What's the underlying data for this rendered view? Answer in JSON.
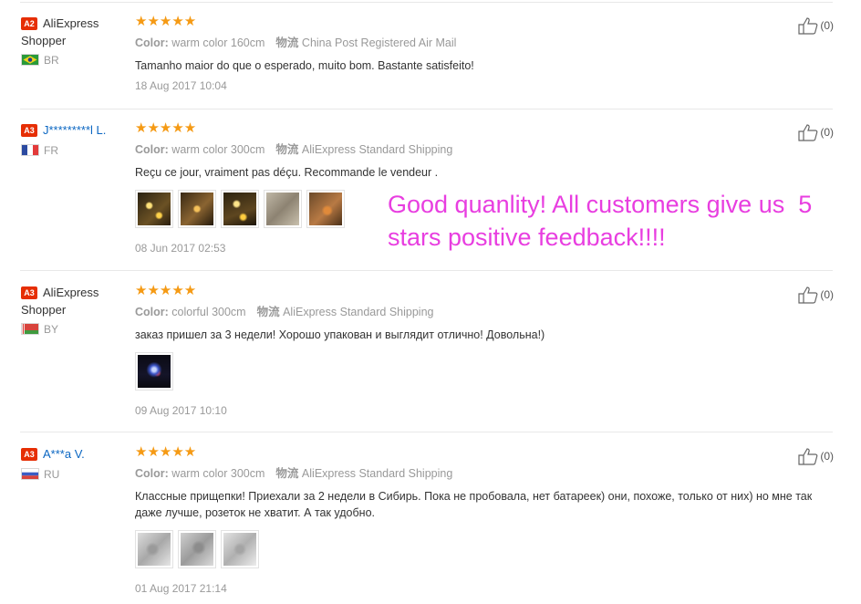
{
  "reviews": [
    {
      "level": "A2",
      "name": "AliExpress Shopper",
      "name_is_link": false,
      "country": "BR",
      "stars": "★★★★★",
      "color_label": "Color:",
      "color_value": "warm color 160cm",
      "shipping_label": "物流",
      "shipping_value": "China Post Registered Air Mail",
      "text": "Tamanho maior do que o esperado, muito bom. Bastante satisfeito!",
      "date": "18 Aug 2017 10:04",
      "helpful": "(0)",
      "rating": 5
    },
    {
      "level": "A3",
      "name": "J*********l L.",
      "name_is_link": true,
      "country": "FR",
      "stars": "★★★★★",
      "color_label": "Color:",
      "color_value": "warm color 300cm",
      "shipping_label": "物流",
      "shipping_value": "AliExpress Standard Shipping",
      "text": "Reçu ce jour, vraiment pas déçu. Recommande le vendeur .",
      "date": "08 Jun 2017 02:53",
      "helpful": "(0)",
      "rating": 5
    },
    {
      "level": "A3",
      "name": "AliExpress Shopper",
      "name_is_link": false,
      "country": "BY",
      "stars": "★★★★★",
      "color_label": "Color:",
      "color_value": "colorful 300cm",
      "shipping_label": "物流",
      "shipping_value": "AliExpress Standard Shipping",
      "text": "заказ пришел за 3 недели! Хорошо упакован и выглядит отлично! Довольна!)",
      "date": "09 Aug 2017 10:10",
      "helpful": "(0)",
      "rating": 5
    },
    {
      "level": "A3",
      "name": "A***a V.",
      "name_is_link": true,
      "country": "RU",
      "stars": "★★★★★",
      "color_label": "Color:",
      "color_value": "warm color 300cm",
      "shipping_label": "物流",
      "shipping_value": "AliExpress Standard Shipping",
      "text": "Классные прищепки! Приехали за 2 недели в Сибирь. Пока не пробовала, нет батареек) они, похоже, только от них) но мне так даже лучше, розеток не хватит. А так удобно.",
      "date": "01 Aug 2017 21:14",
      "helpful": "(0)",
      "rating": 5
    }
  ],
  "promo": {
    "line1": "Good quanlity! All customers give us  5",
    "line2": "stars positive feedback!!!!"
  },
  "colors": {
    "accent_star": "#f59a14",
    "level_badge": "#e62e04",
    "promo_text": "#e83ee0",
    "link": "#0a66c2"
  }
}
